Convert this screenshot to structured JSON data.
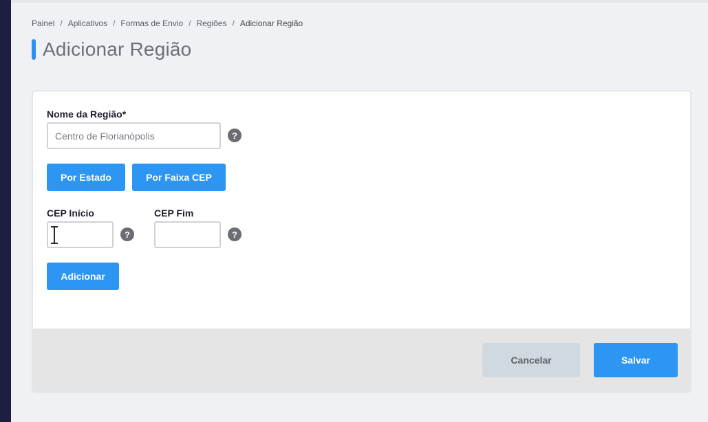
{
  "breadcrumb": {
    "items": [
      "Painel",
      "Aplicativos",
      "Formas de Envio",
      "Regiões"
    ],
    "current": "Adicionar Região",
    "separator": "/"
  },
  "page": {
    "title": "Adicionar Região"
  },
  "form": {
    "region_name": {
      "label": "Nome da Região*",
      "placeholder": "Centro de Florianópolis",
      "help": "?"
    },
    "mode_buttons": {
      "by_state": "Por Estado",
      "by_zip_range": "Por Faixa CEP"
    },
    "cep_start": {
      "label": "CEP Início",
      "value": "",
      "help": "?"
    },
    "cep_end": {
      "label": "CEP Fim",
      "value": "",
      "help": "?"
    },
    "add_button": "Adicionar"
  },
  "footer": {
    "cancel": "Cancelar",
    "save": "Salvar"
  },
  "colors": {
    "accent": "#2d95f2",
    "sidebar": "#1e1e40",
    "cancel_bg": "#d0d9df",
    "help_icon": "#6b6d73"
  },
  "icons": [
    "help-icon",
    "text-cursor-icon"
  ]
}
